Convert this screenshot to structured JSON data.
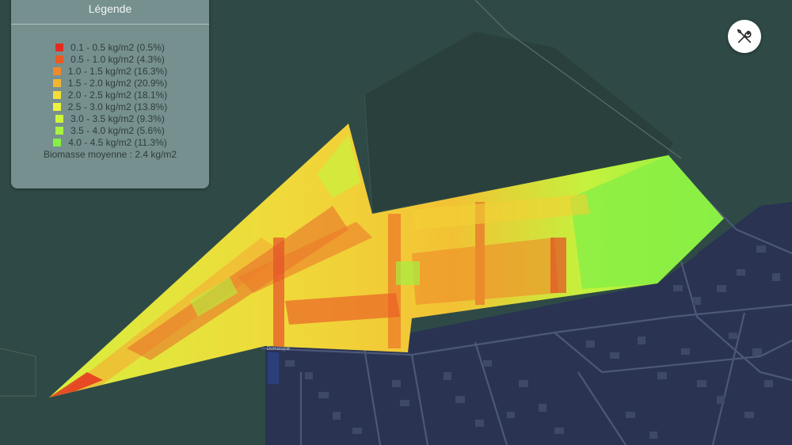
{
  "legend": {
    "title": "Légende",
    "items": [
      {
        "label": "0.1 - 0.5 kg/m2 (0.5%)",
        "color": "#e52a1f"
      },
      {
        "label": "0.5 - 1.0 kg/m2 (4.3%)",
        "color": "#ea5a22"
      },
      {
        "label": "1.0 - 1.5 kg/m2 (16.3%)",
        "color": "#ef8a2a"
      },
      {
        "label": "1.5 - 2.0 kg/m2 (20.9%)",
        "color": "#f4b532"
      },
      {
        "label": "2.0 - 2.5 kg/m2 (18.1%)",
        "color": "#f5de38"
      },
      {
        "label": "2.5 - 3.0 kg/m2 (13.8%)",
        "color": "#eef23c"
      },
      {
        "label": "3.0 - 3.5 kg/m2 (9.3%)",
        "color": "#cdf53c"
      },
      {
        "label": "3.5 - 4.0 kg/m2 (5.6%)",
        "color": "#aaf23f"
      },
      {
        "label": "4.0 - 4.5 kg/m2 (11.3%)",
        "color": "#86ee44"
      }
    ],
    "average": "Biomasse moyenne : 2.4 kg/m2"
  },
  "tools_icon": "wrench-screwdriver-icon",
  "road_label": "Dumasque"
}
